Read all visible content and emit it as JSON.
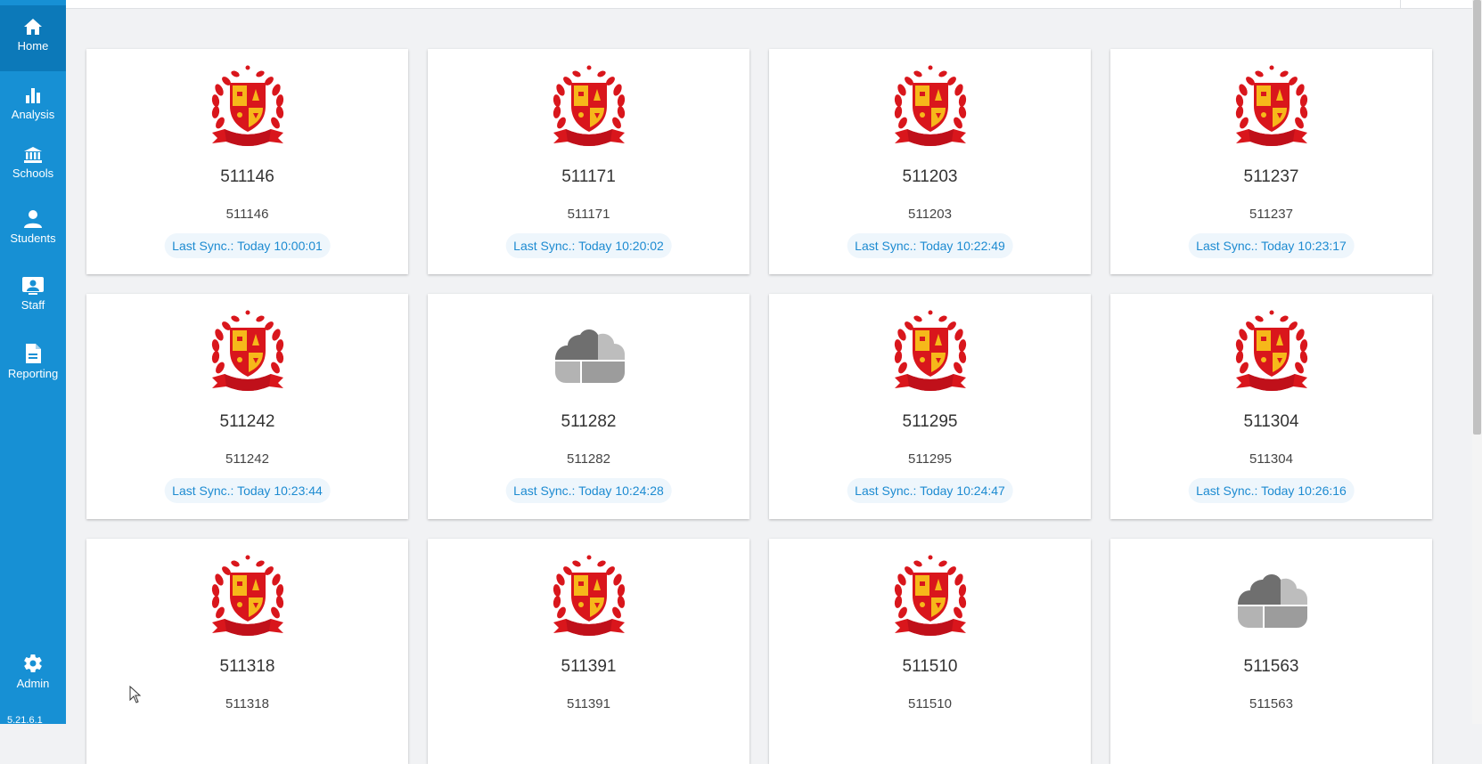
{
  "sidebar": {
    "items": [
      {
        "label": "Home",
        "icon": "home-icon"
      },
      {
        "label": "Analysis",
        "icon": "bar-chart-icon"
      },
      {
        "label": "Schools",
        "icon": "institution-icon"
      },
      {
        "label": "Students",
        "icon": "person-icon"
      },
      {
        "label": "Staff",
        "icon": "staff-icon"
      },
      {
        "label": "Reporting",
        "icon": "document-icon"
      }
    ],
    "admin": {
      "label": "Admin",
      "icon": "gear-icon"
    },
    "version": "5.21.6.1"
  },
  "colors": {
    "sidebar": "#1790d4",
    "sidebar_active": "#0c79b9",
    "sync_text": "#1d8bd1",
    "crest_red": "#d9161c",
    "crest_yellow": "#f6b81a"
  },
  "schools": [
    {
      "title": "511146",
      "code": "511146",
      "sync": "Last Sync.: Today 10:00:01",
      "logo": "crest"
    },
    {
      "title": "511171",
      "code": "511171",
      "sync": "Last Sync.: Today 10:20:02",
      "logo": "crest"
    },
    {
      "title": "511203",
      "code": "511203",
      "sync": "Last Sync.: Today 10:22:49",
      "logo": "crest"
    },
    {
      "title": "511237",
      "code": "511237",
      "sync": "Last Sync.: Today 10:23:17",
      "logo": "crest"
    },
    {
      "title": "511242",
      "code": "511242",
      "sync": "Last Sync.: Today 10:23:44",
      "logo": "crest"
    },
    {
      "title": "511282",
      "code": "511282",
      "sync": "Last Sync.: Today 10:24:28",
      "logo": "cloud"
    },
    {
      "title": "511295",
      "code": "511295",
      "sync": "Last Sync.: Today 10:24:47",
      "logo": "crest"
    },
    {
      "title": "511304",
      "code": "511304",
      "sync": "Last Sync.: Today 10:26:16",
      "logo": "crest"
    },
    {
      "title": "511318",
      "code": "511318",
      "sync": "",
      "logo": "crest"
    },
    {
      "title": "511391",
      "code": "511391",
      "sync": "",
      "logo": "crest"
    },
    {
      "title": "511510",
      "code": "511510",
      "sync": "",
      "logo": "crest"
    },
    {
      "title": "511563",
      "code": "511563",
      "sync": "",
      "logo": "cloud"
    }
  ]
}
